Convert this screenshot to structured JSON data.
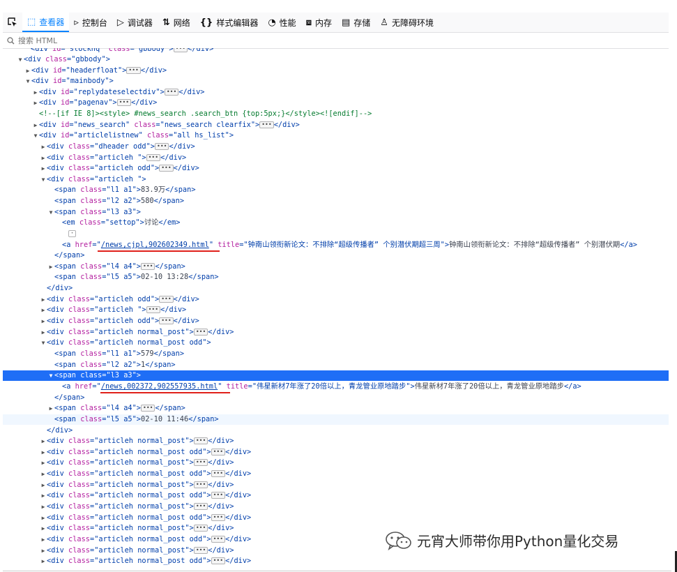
{
  "toolbar": {
    "tabs": [
      {
        "label": "查看器",
        "icon": "inspector-icon",
        "glyph": "⬚"
      },
      {
        "label": "控制台",
        "icon": "console-icon",
        "glyph": "▹"
      },
      {
        "label": "调试器",
        "icon": "debugger-icon",
        "glyph": "▷"
      },
      {
        "label": "网络",
        "icon": "network-icon",
        "glyph": "⇅"
      },
      {
        "label": "样式编辑器",
        "icon": "style-editor-icon",
        "glyph": "{}"
      },
      {
        "label": "性能",
        "icon": "performance-icon",
        "glyph": "◔"
      },
      {
        "label": "内存",
        "icon": "memory-icon",
        "glyph": "⧈"
      },
      {
        "label": "存储",
        "icon": "storage-icon",
        "glyph": "▤"
      },
      {
        "label": "无障碍环境",
        "icon": "accessibility-icon",
        "glyph": "♙"
      }
    ],
    "active_color": "#0a84ff"
  },
  "search": {
    "placeholder": "搜索 HTML"
  },
  "tree": {
    "line_01": {
      "tag": "div",
      "id": "stockhq",
      "cls": "gbbody"
    },
    "line_02": {
      "tag": "div",
      "cls": "gbbody"
    },
    "line_03": {
      "tag": "div",
      "id": "headerfloat"
    },
    "line_04": {
      "tag": "div",
      "id": "mainbody"
    },
    "line_05": {
      "tag": "div",
      "id": "replydateselectdiv"
    },
    "line_06": {
      "tag": "div",
      "id": "pagenav"
    },
    "line_07": {
      "comment": "<!--[if IE 8]><style> #news_search .search_btn {top:5px;}</style><![endif]-->"
    },
    "line_08": {
      "tag": "div",
      "id": "news_search",
      "cls": "news_search clearfix"
    },
    "line_09": {
      "tag": "div",
      "id": "articlelistnew",
      "cls": "all hs_list"
    },
    "line_10": {
      "tag": "div",
      "cls": "dheader odd"
    },
    "line_11": {
      "tag": "div",
      "cls": "articleh "
    },
    "line_12": {
      "tag": "div",
      "cls": "articleh odd"
    },
    "line_13": {
      "tag": "div",
      "cls": "articleh "
    },
    "line_14": {
      "tag": "span",
      "cls": "l1 a1",
      "text": "83.9万"
    },
    "line_15": {
      "tag": "span",
      "cls": "l2 a2",
      "text": "580"
    },
    "line_16": {
      "tag": "span",
      "cls": "l3 a3"
    },
    "line_17": {
      "tag": "em",
      "cls": "settop",
      "text": "讨论"
    },
    "line_19": {
      "tag": "a",
      "href": "/news,cjpl,902602349.html",
      "title": "钟南山领衔新论文：不排除“超级传播者” 个别潜伏期超三周",
      "text": "钟南山领衔新论文：不排除“超级传播者” 个别潜伏期"
    },
    "line_20": {
      "tag": "span"
    },
    "line_21": {
      "tag": "span",
      "cls": "l4 a4"
    },
    "line_22": {
      "tag": "span",
      "cls": "l5 a5",
      "text": "02-10 13:28"
    },
    "line_23": {
      "tag": "div"
    },
    "line_24": {
      "tag": "div",
      "cls": "articleh odd"
    },
    "line_25": {
      "tag": "div",
      "cls": "articleh "
    },
    "line_26": {
      "tag": "div",
      "cls": "articleh odd"
    },
    "line_27": {
      "tag": "div",
      "cls": "articleh normal_post"
    },
    "line_28": {
      "tag": "div",
      "cls": "articleh normal_post odd"
    },
    "line_29": {
      "tag": "span",
      "cls": "l1 a1",
      "text": "579"
    },
    "line_30": {
      "tag": "span",
      "cls": "l2 a2",
      "text": "1"
    },
    "line_31": {
      "tag": "span",
      "cls": "l3 a3"
    },
    "line_32": {
      "tag": "a",
      "href": "/news,002372,902557935.html",
      "title": "伟星新材7年涨了20倍以上，青龙管业原地踏步",
      "text": "伟星新材7年涨了20倍以上，青龙管业原地踏步"
    },
    "line_33": {
      "tag": "span"
    },
    "line_34": {
      "tag": "span",
      "cls": "l4 a4"
    },
    "line_35": {
      "tag": "span",
      "cls": "l5 a5",
      "text": "02-10 11:46"
    },
    "line_36": {
      "tag": "div"
    },
    "line_37": {
      "tag": "div",
      "cls": "articleh normal_post"
    },
    "line_38": {
      "tag": "div",
      "cls": "articleh normal_post odd"
    },
    "line_39": {
      "tag": "div",
      "cls": "articleh normal_post"
    },
    "line_40": {
      "tag": "div",
      "cls": "articleh normal_post odd"
    },
    "line_41": {
      "tag": "div",
      "cls": "articleh normal_post"
    },
    "line_42": {
      "tag": "div",
      "cls": "articleh normal_post odd"
    },
    "line_43": {
      "tag": "div",
      "cls": "articleh normal_post"
    },
    "line_44": {
      "tag": "div",
      "cls": "articleh normal_post odd"
    },
    "line_45": {
      "tag": "div",
      "cls": "articleh normal_post"
    },
    "line_46": {
      "tag": "div",
      "cls": "articleh normal_post odd"
    },
    "line_47": {
      "tag": "div",
      "cls": "articleh normal_post"
    },
    "line_48": {
      "tag": "div",
      "cls": "articleh normal_post odd"
    }
  },
  "colors": {
    "selected_row": "#1f6ef6",
    "highlight_underline": "#e0201a",
    "tag": "#003eaa",
    "attr_name": "#b31e9f",
    "comment": "#057b2f"
  },
  "watermark": {
    "text": "元宵大师带你用Python量化交易",
    "icon": "wechat-icon"
  }
}
